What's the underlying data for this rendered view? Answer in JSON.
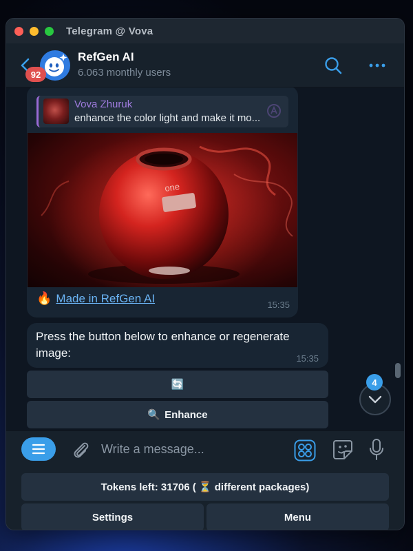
{
  "window": {
    "title": "Telegram @ Vova",
    "controls": [
      "close",
      "minimize",
      "maximize"
    ],
    "colors": {
      "close": "#fe5f57",
      "minimize": "#febc2e",
      "maximize": "#28c840"
    }
  },
  "header": {
    "back_icon": "chevron-left-icon",
    "unread_badge": "92",
    "chat_name": "RefGen AI",
    "chat_subtitle": "6.063 monthly users",
    "search_icon": "search-icon",
    "more_icon": "more-dots-icon",
    "accent": "#3a9ee9"
  },
  "messages": [
    {
      "reply": {
        "author": "Vova Zhuruk",
        "text": "enhance the color light and make it mo..."
      },
      "image_description_icon": "photo-speaker",
      "caption_emoji": "🔥",
      "caption_link": "Made in RefGen AI",
      "time": "15:35"
    },
    {
      "text": "Press the button below to enhance or regenerate image:",
      "time": "15:35"
    }
  ],
  "inline_buttons": [
    {
      "icon": "🔄",
      "label": ""
    },
    {
      "icon": "🔍",
      "label": "Enhance"
    }
  ],
  "scroll_down": {
    "badge": "4",
    "icon": "chevron-down-icon"
  },
  "composer": {
    "menu_icon": "menu-lines-icon",
    "attach_icon": "paperclip-icon",
    "placeholder": "Write a message...",
    "apps_icon": "apps-grid-icon",
    "sticker_icon": "sticker-icon",
    "mic_icon": "microphone-icon"
  },
  "reply_keyboard": {
    "row1": "Tokens left: 31706 ( ⏳ different packages)",
    "row2": [
      "Settings",
      "Menu"
    ]
  }
}
